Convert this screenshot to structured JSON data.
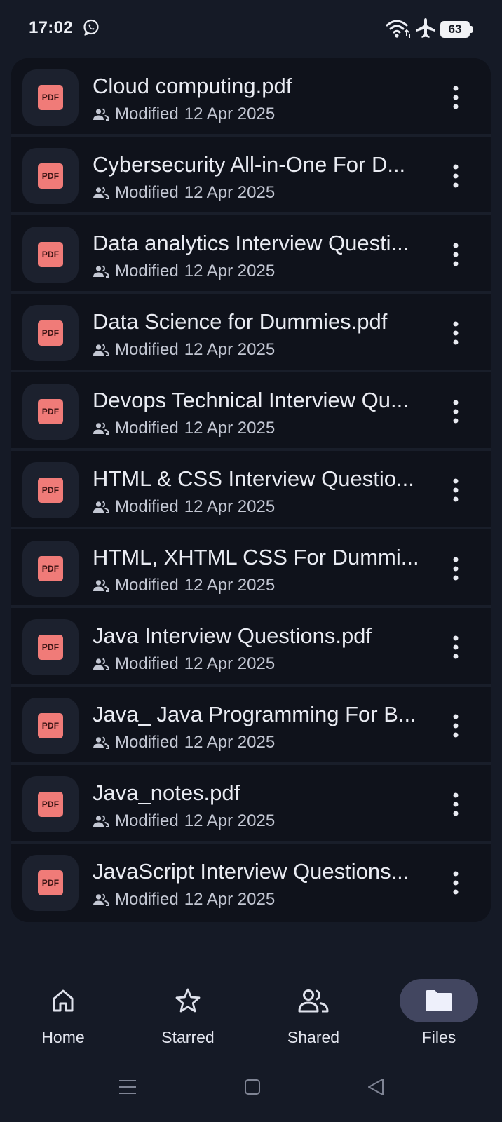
{
  "status_bar": {
    "time": "17:02",
    "battery_level": "63",
    "icons": [
      "whatsapp-icon",
      "wifi-icon",
      "airplane-mode-icon",
      "battery-icon"
    ]
  },
  "files": [
    {
      "name": "Cloud computing.pdf",
      "type_label": "PDF",
      "modified_label": "Modified",
      "modified_date": "12 Apr 2025"
    },
    {
      "name": "Cybersecurity All-in-One For D...",
      "type_label": "PDF",
      "modified_label": "Modified",
      "modified_date": "12 Apr 2025"
    },
    {
      "name": "Data analytics Interview Questi...",
      "type_label": "PDF",
      "modified_label": "Modified",
      "modified_date": "12 Apr 2025"
    },
    {
      "name": "Data Science for Dummies.pdf",
      "type_label": "PDF",
      "modified_label": "Modified",
      "modified_date": "12 Apr 2025"
    },
    {
      "name": "Devops Technical Interview Qu...",
      "type_label": "PDF",
      "modified_label": "Modified",
      "modified_date": "12 Apr 2025"
    },
    {
      "name": "HTML & CSS Interview Questio...",
      "type_label": "PDF",
      "modified_label": "Modified",
      "modified_date": "12 Apr 2025"
    },
    {
      "name": "HTML, XHTML  CSS For Dummi...",
      "type_label": "PDF",
      "modified_label": "Modified",
      "modified_date": "12 Apr 2025"
    },
    {
      "name": "Java Interview Questions.pdf",
      "type_label": "PDF",
      "modified_label": "Modified",
      "modified_date": "12 Apr 2025"
    },
    {
      "name": "Java_ Java Programming For B...",
      "type_label": "PDF",
      "modified_label": "Modified",
      "modified_date": "12 Apr 2025"
    },
    {
      "name": "Java_notes.pdf",
      "type_label": "PDF",
      "modified_label": "Modified",
      "modified_date": "12 Apr 2025"
    },
    {
      "name": "JavaScript Interview Questions...",
      "type_label": "PDF",
      "modified_label": "Modified",
      "modified_date": "12 Apr 2025"
    }
  ],
  "bottom_nav": {
    "active": "Files",
    "items": [
      {
        "label": "Home",
        "icon": "home-icon"
      },
      {
        "label": "Starred",
        "icon": "star-icon"
      },
      {
        "label": "Shared",
        "icon": "people-icon"
      },
      {
        "label": "Files",
        "icon": "folder-icon"
      }
    ]
  },
  "colors": {
    "background": "#151a26",
    "list_background": "#0f121b",
    "pdf_badge": "#f07b78",
    "active_nav_pill": "#424660"
  }
}
